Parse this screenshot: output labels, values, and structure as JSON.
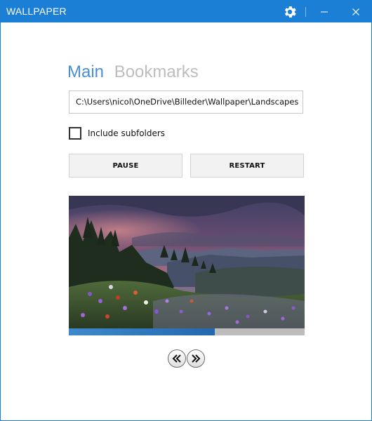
{
  "window": {
    "title": "WALLPAPER",
    "accent_color": "#1c7fd6"
  },
  "titlebar": {
    "settings_icon": "gear-icon",
    "minimize_icon": "minimize-icon",
    "close_icon": "close-icon"
  },
  "tabs": [
    {
      "label": "Main",
      "active": true
    },
    {
      "label": "Bookmarks",
      "active": false
    }
  ],
  "folder": {
    "path": "C:\\Users\\nicol\\OneDrive\\Billeder\\Wallpaper\\Landscapes"
  },
  "options": {
    "include_subfolders_label": "Include subfolders",
    "include_subfolders_checked": false
  },
  "buttons": {
    "pause_label": "PAUSE",
    "restart_label": "RESTART"
  },
  "slideshow": {
    "progress_fraction": 0.62,
    "previous_icon": "rewind-icon",
    "next_icon": "fast-forward-icon"
  }
}
